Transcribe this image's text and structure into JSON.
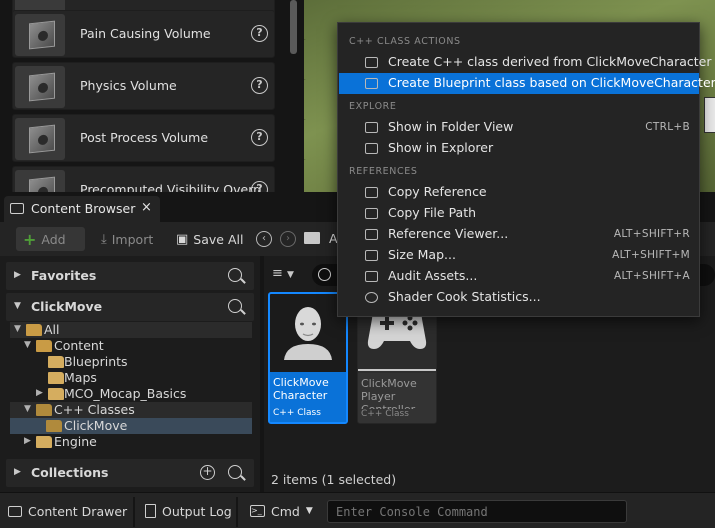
{
  "placement_list": {
    "items": [
      {
        "label": "Pain Causing Volume"
      },
      {
        "label": "Physics Volume"
      },
      {
        "label": "Post Process Volume"
      },
      {
        "label": "Precomputed Visibility Overri"
      }
    ]
  },
  "content_browser": {
    "tab_label": "Content Browser",
    "tab_close": "×",
    "toolbar": {
      "add_label": "Add",
      "import_label": "Import",
      "save_all_label": "Save All",
      "path_label": "A"
    },
    "sections": {
      "favorites": "Favorites",
      "project": "ClickMove",
      "collections": "Collections"
    },
    "tree": [
      {
        "label": "All",
        "depth": 0
      },
      {
        "label": "Content",
        "depth": 1
      },
      {
        "label": "Blueprints",
        "depth": 2
      },
      {
        "label": "Maps",
        "depth": 2
      },
      {
        "label": "MCO_Mocap_Basics",
        "depth": 2
      },
      {
        "label": "C++ Classes",
        "depth": 1
      },
      {
        "label": "ClickMove",
        "depth": 2
      },
      {
        "label": "Engine",
        "depth": 1
      }
    ],
    "assets": [
      {
        "name": "ClickMove Character",
        "class_label": "C++ Class",
        "selected": true
      },
      {
        "name": "ClickMove Player Controller",
        "class_label": "C++ Class",
        "selected": false
      }
    ],
    "status_text": "2 items (1 selected)"
  },
  "bottom_bar": {
    "content_drawer": "Content Drawer",
    "output_log": "Output Log",
    "cmd": "Cmd",
    "console_placeholder": "Enter Console Command"
  },
  "context_menu": {
    "sections": [
      {
        "title": "C++ CLASS ACTIONS",
        "items": [
          {
            "label": "Create C++ class derived from ClickMoveCharacter",
            "shortcut": "",
            "icon": "cpp-class-icon",
            "highlighted": false
          },
          {
            "label": "Create Blueprint class based on ClickMoveCharacter",
            "shortcut": "",
            "icon": "blueprint-class-icon",
            "highlighted": true
          }
        ]
      },
      {
        "title": "EXPLORE",
        "items": [
          {
            "label": "Show in Folder View",
            "shortcut": "CTRL+B",
            "icon": "folder-search-icon"
          },
          {
            "label": "Show in Explorer",
            "shortcut": "",
            "icon": "explorer-icon"
          }
        ]
      },
      {
        "title": "REFERENCES",
        "items": [
          {
            "label": "Copy Reference",
            "shortcut": "",
            "icon": "copy-icon"
          },
          {
            "label": "Copy File Path",
            "shortcut": "",
            "icon": "copy-path-icon"
          },
          {
            "label": "Reference Viewer...",
            "shortcut": "ALT+SHIFT+R",
            "icon": "reference-viewer-icon"
          },
          {
            "label": "Size Map...",
            "shortcut": "ALT+SHIFT+M",
            "icon": "size-map-icon"
          },
          {
            "label": "Audit Assets...",
            "shortcut": "ALT+SHIFT+A",
            "icon": "audit-icon"
          },
          {
            "label": "Shader Cook Statistics...",
            "shortcut": "",
            "icon": "shader-icon"
          }
        ]
      }
    ]
  },
  "colors": {
    "selection_blue": "#0a72d8",
    "panel_bg": "#1c1c1c",
    "folder_gold": "#d5ad5f"
  }
}
